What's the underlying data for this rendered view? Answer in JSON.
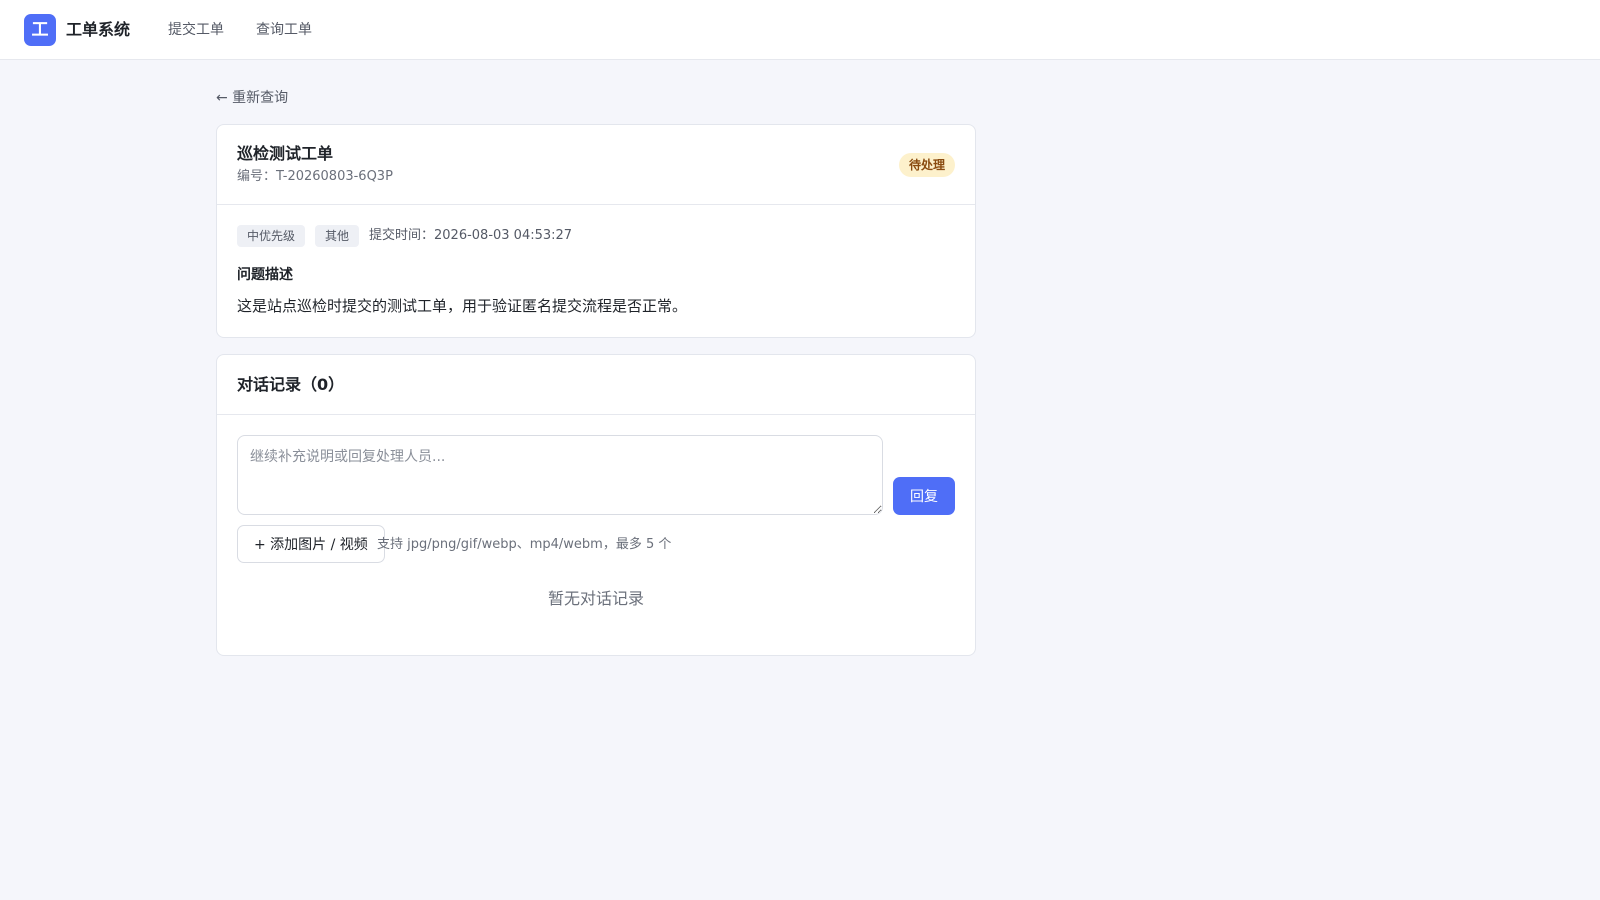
{
  "header": {
    "logo_char": "工",
    "app_title": "工单系统",
    "nav": [
      {
        "label": "提交工单"
      },
      {
        "label": "查询工单"
      }
    ]
  },
  "back_link": "← 重新查询",
  "ticket": {
    "title": "巡检测试工单",
    "id_text": "编号：T-20260803-6Q3P",
    "status": "待处理",
    "tags": [
      "中优先级",
      "其他"
    ],
    "submit_time": "提交时间：2026-08-03 04:53:27",
    "description_label": "问题描述",
    "description": "这是站点巡检时提交的测试工单，用于验证匿名提交流程是否正常。"
  },
  "dialog": {
    "title": "对话记录（0）",
    "reply_placeholder": "继续补充说明或回复处理人员...",
    "reply_value": "",
    "reply_button": "回复",
    "upload_button": "+ 添加图片 / 视频",
    "upload_hint": "支持 jpg/png/gif/webp、mp4/webm，最多 5 个",
    "empty_text": "暂无对话记录"
  },
  "colors": {
    "accent": "#4f6ef7",
    "status_bg": "#fdf1cc",
    "status_text": "#8a4b10"
  }
}
